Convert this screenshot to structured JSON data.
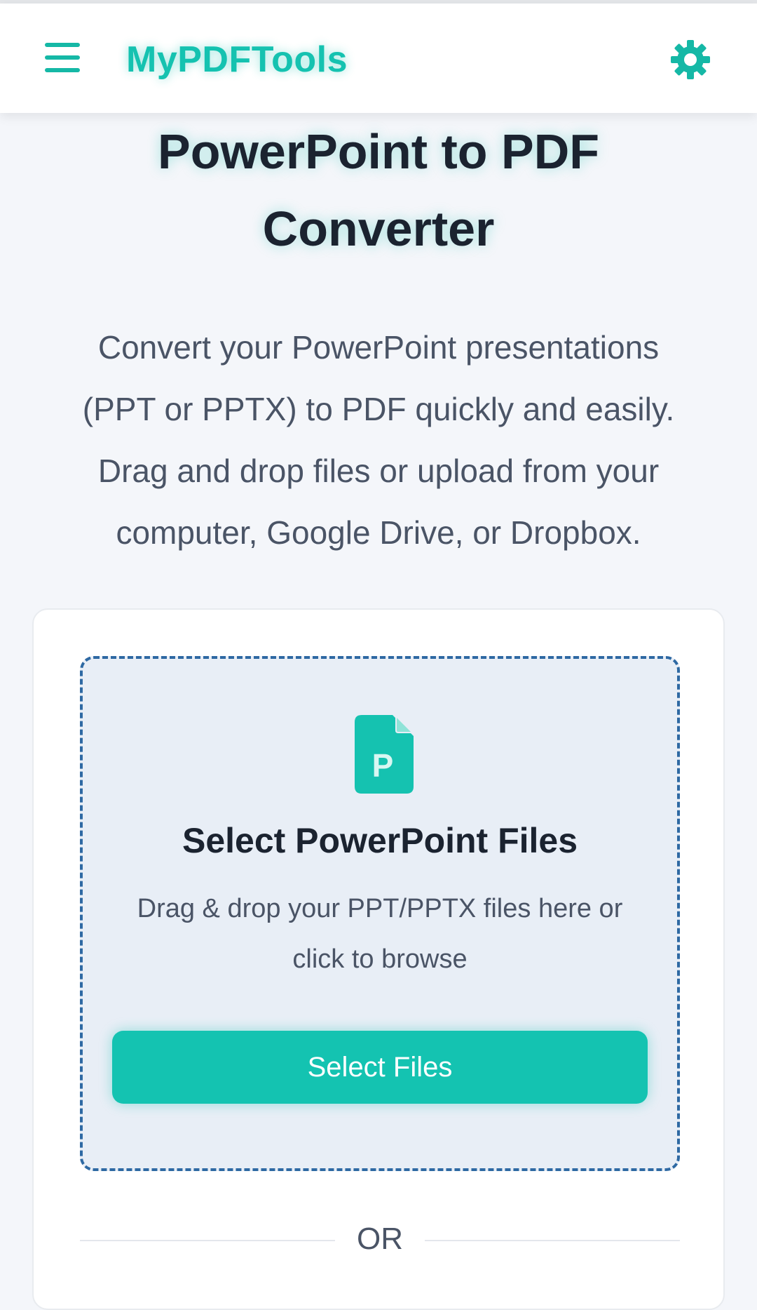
{
  "header": {
    "brand": "MyPDFTools",
    "menu_icon": "hamburger-menu-icon",
    "settings_icon": "gear-icon",
    "accent_color": "#15c2b0"
  },
  "main": {
    "title_line1": "PowerPoint to PDF",
    "title_line2": "Converter",
    "description_lines": [
      "Convert your PowerPoint presentations",
      "(PPT or PPTX) to PDF quickly and easily.",
      "Drag and drop files or upload from your",
      "computer, Google Drive, or Dropbox."
    ]
  },
  "upload": {
    "file_icon": "powerpoint-file-icon",
    "file_icon_letter": "P",
    "title": "Select PowerPoint Files",
    "hint_line1": "Drag & drop your PPT/PPTX files here or",
    "hint_line2": "click to browse",
    "button_label": "Select Files",
    "button_color": "#14c3b1",
    "dropzone_border_color": "#2e69a3"
  },
  "divider": {
    "label": "OR"
  }
}
